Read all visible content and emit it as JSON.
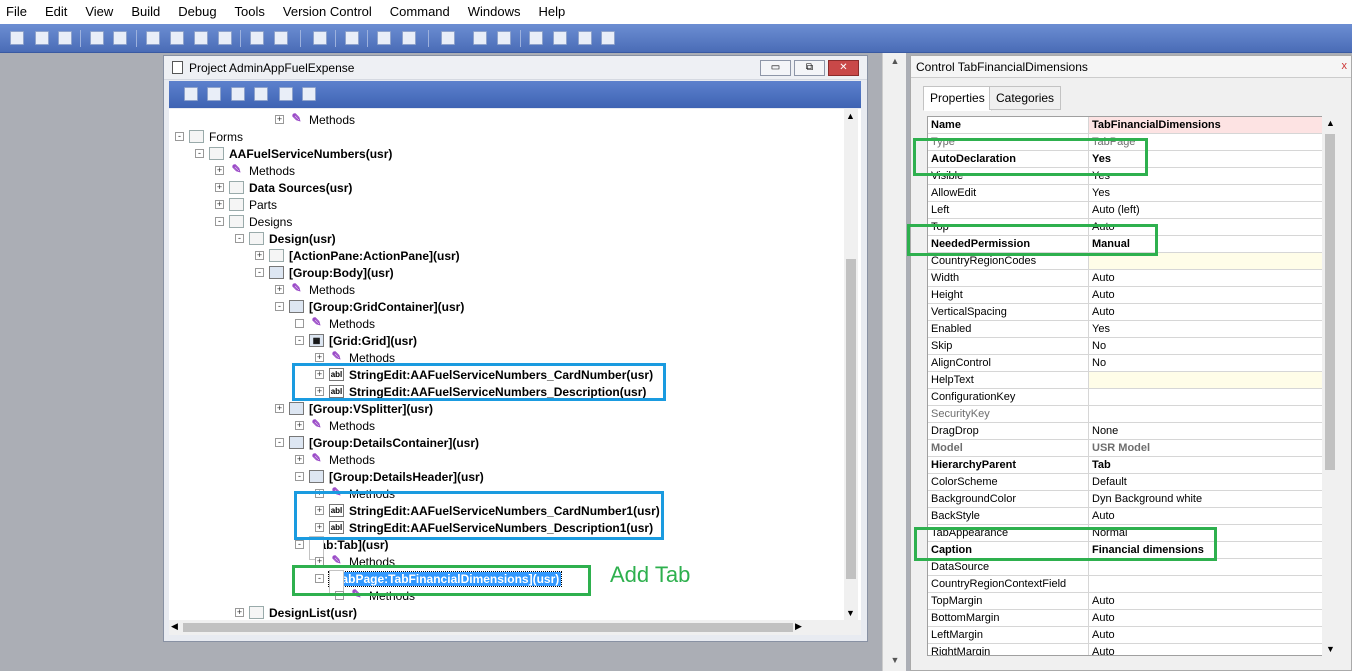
{
  "menu": [
    "File",
    "Edit",
    "View",
    "Build",
    "Debug",
    "Tools",
    "Version Control",
    "Command",
    "Windows",
    "Help"
  ],
  "project": {
    "title": "Project AdminAppFuelExpense",
    "buttons": {
      "minimize": "▭",
      "restore": "⧉",
      "close": "✕"
    },
    "tree": [
      {
        "indent": 5,
        "exp": "+",
        "icon": "M",
        "label": "Methods",
        "bold": false
      },
      {
        "indent": 0,
        "exp": "-",
        "icon": "F",
        "label": "Forms",
        "bold": false
      },
      {
        "indent": 1,
        "exp": "-",
        "icon": "F",
        "label": "AAFuelServiceNumbers(usr)",
        "bold": true
      },
      {
        "indent": 2,
        "exp": "+",
        "icon": "M",
        "label": "Methods",
        "bold": false
      },
      {
        "indent": 2,
        "exp": "+",
        "icon": "D",
        "label": "Data Sources(usr)",
        "bold": true
      },
      {
        "indent": 2,
        "exp": "+",
        "icon": "P",
        "label": "Parts",
        "bold": false
      },
      {
        "indent": 2,
        "exp": "-",
        "icon": "G",
        "label": "Designs",
        "bold": false
      },
      {
        "indent": 3,
        "exp": "-",
        "icon": "G",
        "label": "Design(usr)",
        "bold": true
      },
      {
        "indent": 4,
        "exp": "+",
        "icon": "A",
        "label": "[ActionPane:ActionPane](usr)",
        "bold": true
      },
      {
        "indent": 4,
        "exp": "-",
        "icon": "X",
        "label": "[Group:Body](usr)",
        "bold": true
      },
      {
        "indent": 5,
        "exp": "+",
        "icon": "M",
        "label": "Methods",
        "bold": false
      },
      {
        "indent": 5,
        "exp": "-",
        "icon": "X",
        "label": "[Group:GridContainer](usr)",
        "bold": true
      },
      {
        "indent": 6,
        "exp": " ",
        "icon": "M",
        "label": "Methods",
        "bold": false
      },
      {
        "indent": 6,
        "exp": "-",
        "icon": "T",
        "label": "[Grid:Grid](usr)",
        "bold": true
      },
      {
        "indent": 7,
        "exp": "+",
        "icon": "M",
        "label": "Methods",
        "bold": false
      },
      {
        "indent": 7,
        "exp": "+",
        "icon": "S",
        "label": "StringEdit:AAFuelServiceNumbers_CardNumber(usr)",
        "bold": true
      },
      {
        "indent": 7,
        "exp": "+",
        "icon": "S",
        "label": "StringEdit:AAFuelServiceNumbers_Description(usr)",
        "bold": true
      },
      {
        "indent": 5,
        "exp": "+",
        "icon": "X",
        "label": "[Group:VSplitter](usr)",
        "bold": true
      },
      {
        "indent": 6,
        "exp": "+",
        "icon": "M",
        "label": "Methods",
        "bold": false
      },
      {
        "indent": 5,
        "exp": "-",
        "icon": "X",
        "label": "[Group:DetailsContainer](usr)",
        "bold": true
      },
      {
        "indent": 6,
        "exp": "+",
        "icon": "M",
        "label": "Methods",
        "bold": false
      },
      {
        "indent": 6,
        "exp": "-",
        "icon": "X",
        "label": "[Group:DetailsHeader](usr)",
        "bold": true
      },
      {
        "indent": 7,
        "exp": "+",
        "icon": "M",
        "label": "Methods",
        "bold": false
      },
      {
        "indent": 7,
        "exp": "+",
        "icon": "S",
        "label": "StringEdit:AAFuelServiceNumbers_CardNumber1(usr)",
        "bold": true
      },
      {
        "indent": 7,
        "exp": "+",
        "icon": "S",
        "label": "StringEdit:AAFuelServiceNumbers_Description1(usr)",
        "bold": true
      },
      {
        "indent": 6,
        "exp": "-",
        "icon": "B",
        "label": "[Tab:Tab](usr)",
        "bold": true
      },
      {
        "indent": 7,
        "exp": "+",
        "icon": "M",
        "label": "Methods",
        "bold": false
      },
      {
        "indent": 7,
        "exp": "-",
        "icon": "B",
        "label": "[TabPage:TabFinancialDimensions](usr)",
        "bold": true,
        "selected": true
      },
      {
        "indent": 8,
        "exp": " ",
        "icon": "M",
        "label": "Methods",
        "bold": false
      },
      {
        "indent": 3,
        "exp": "+",
        "icon": "G",
        "label": "DesignList(usr)",
        "bold": true
      }
    ]
  },
  "annotation": "Add Tab",
  "properties_panel": {
    "title": "Control TabFinancialDimensions",
    "close": "x",
    "tabs": [
      "Properties",
      "Categories"
    ],
    "rows": [
      {
        "k": "Name",
        "v": "TabFinancialDimensions",
        "style": "bold",
        "vstyle": "pink"
      },
      {
        "k": "Type",
        "v": "TabPage",
        "style": "gray"
      },
      {
        "k": "AutoDeclaration",
        "v": "Yes",
        "style": "bold"
      },
      {
        "k": "Visible",
        "v": "Yes"
      },
      {
        "k": "AllowEdit",
        "v": "Yes"
      },
      {
        "k": "Left",
        "v": "Auto (left)"
      },
      {
        "k": "Top",
        "v": "Auto"
      },
      {
        "k": "NeededPermission",
        "v": "Manual",
        "style": "bold"
      },
      {
        "k": "CountryRegionCodes",
        "v": "",
        "vstyle": "yel"
      },
      {
        "k": "Width",
        "v": "Auto"
      },
      {
        "k": "Height",
        "v": "Auto"
      },
      {
        "k": "VerticalSpacing",
        "v": "Auto"
      },
      {
        "k": "Enabled",
        "v": "Yes"
      },
      {
        "k": "Skip",
        "v": "No"
      },
      {
        "k": "AlignControl",
        "v": "No"
      },
      {
        "k": "HelpText",
        "v": "",
        "vstyle": "yel"
      },
      {
        "k": "ConfigurationKey",
        "v": ""
      },
      {
        "k": "SecurityKey",
        "v": "",
        "style": "gray"
      },
      {
        "k": "DragDrop",
        "v": "None"
      },
      {
        "k": "Model",
        "v": "USR Model",
        "style": "grayb"
      },
      {
        "k": "HierarchyParent",
        "v": "Tab",
        "style": "bold"
      },
      {
        "k": "ColorScheme",
        "v": "Default"
      },
      {
        "k": "BackgroundColor",
        "v": "Dyn Background white"
      },
      {
        "k": "BackStyle",
        "v": "Auto"
      },
      {
        "k": "TabAppearance",
        "v": "Normal"
      },
      {
        "k": "Caption",
        "v": "Financial dimensions",
        "style": "bold"
      },
      {
        "k": "DataSource",
        "v": ""
      },
      {
        "k": "CountryRegionContextField",
        "v": ""
      },
      {
        "k": "TopMargin",
        "v": "Auto"
      },
      {
        "k": "BottomMargin",
        "v": "Auto"
      },
      {
        "k": "LeftMargin",
        "v": "Auto"
      },
      {
        "k": "RightMargin",
        "v": "Auto"
      }
    ]
  }
}
